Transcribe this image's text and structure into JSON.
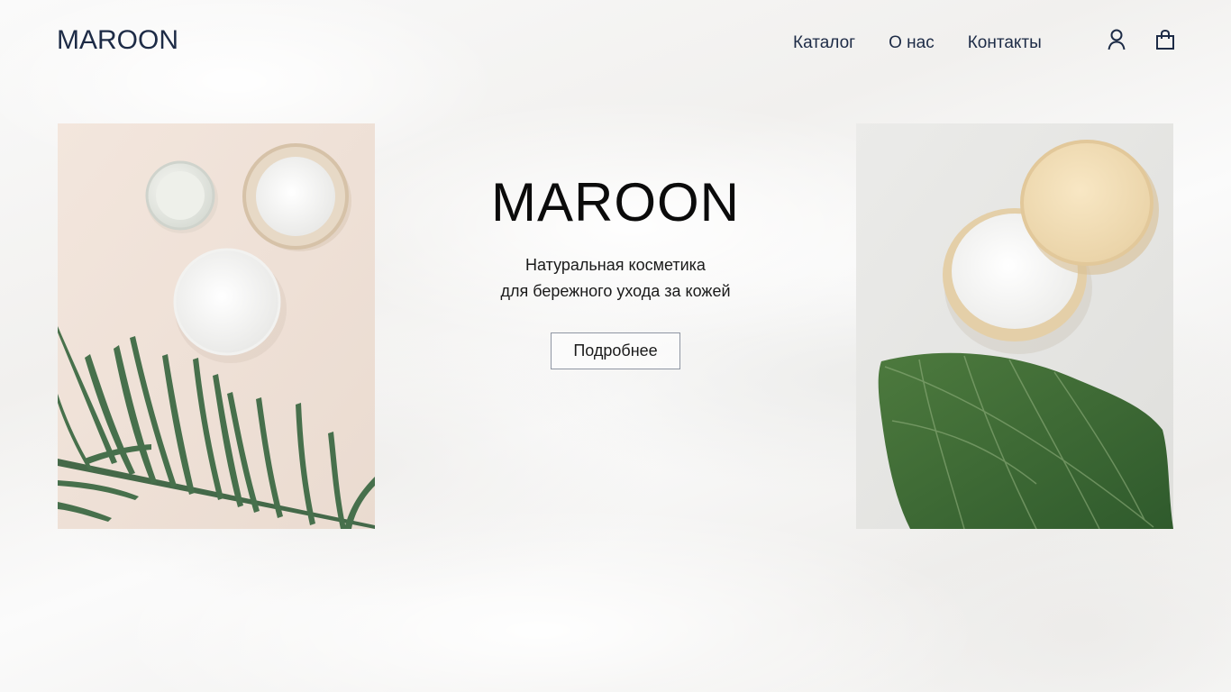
{
  "header": {
    "logo": "MAROON",
    "nav": [
      {
        "label": "Каталог"
      },
      {
        "label": "О нас"
      },
      {
        "label": "Контакты"
      }
    ],
    "icons": [
      "user-icon",
      "shopping-bag-icon"
    ]
  },
  "hero": {
    "title": "MAROON",
    "subtitle_line1": "Натуральная косметика",
    "subtitle_line2": "для бережного ухода за кожей",
    "button_label": "Подробнее"
  },
  "colors": {
    "brand": "#1d2b46",
    "button_border": "#8f96a3",
    "leaf_green": "#3f6b45"
  }
}
